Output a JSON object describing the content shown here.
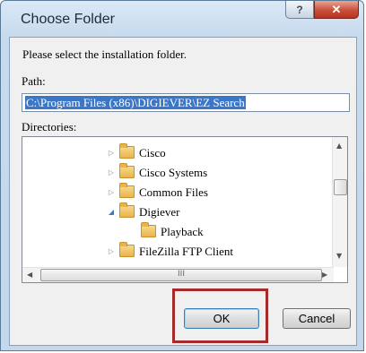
{
  "window": {
    "title": "Choose Folder",
    "help_label": "?",
    "close_label": "✕"
  },
  "instruction": "Please select the installation folder.",
  "path": {
    "label": "Path:",
    "value": "C:\\Program Files (x86)\\DIGIEVER\\EZ Search"
  },
  "directories": {
    "label": "Directories:",
    "items": [
      {
        "label": "Cisco",
        "expander": "▷"
      },
      {
        "label": "Cisco Systems",
        "expander": "▷"
      },
      {
        "label": "Common Files",
        "expander": "▷"
      },
      {
        "label": "Digiever",
        "expander": "◢"
      },
      {
        "label": "Playback",
        "expander": ""
      },
      {
        "label": "FileZilla FTP Client",
        "expander": "▷"
      }
    ],
    "hscroll_grip": "III",
    "arrows": {
      "up": "▲",
      "down": "▼",
      "left": "◀",
      "right": "▶"
    }
  },
  "buttons": {
    "ok": "OK",
    "cancel": "Cancel"
  },
  "colors": {
    "selection": "#3b77c9",
    "highlight_box": "#a52a2a",
    "close_button": "#c9503a"
  },
  "icons": {
    "folder": "folder-icon",
    "help": "help-icon",
    "close": "close-icon"
  }
}
